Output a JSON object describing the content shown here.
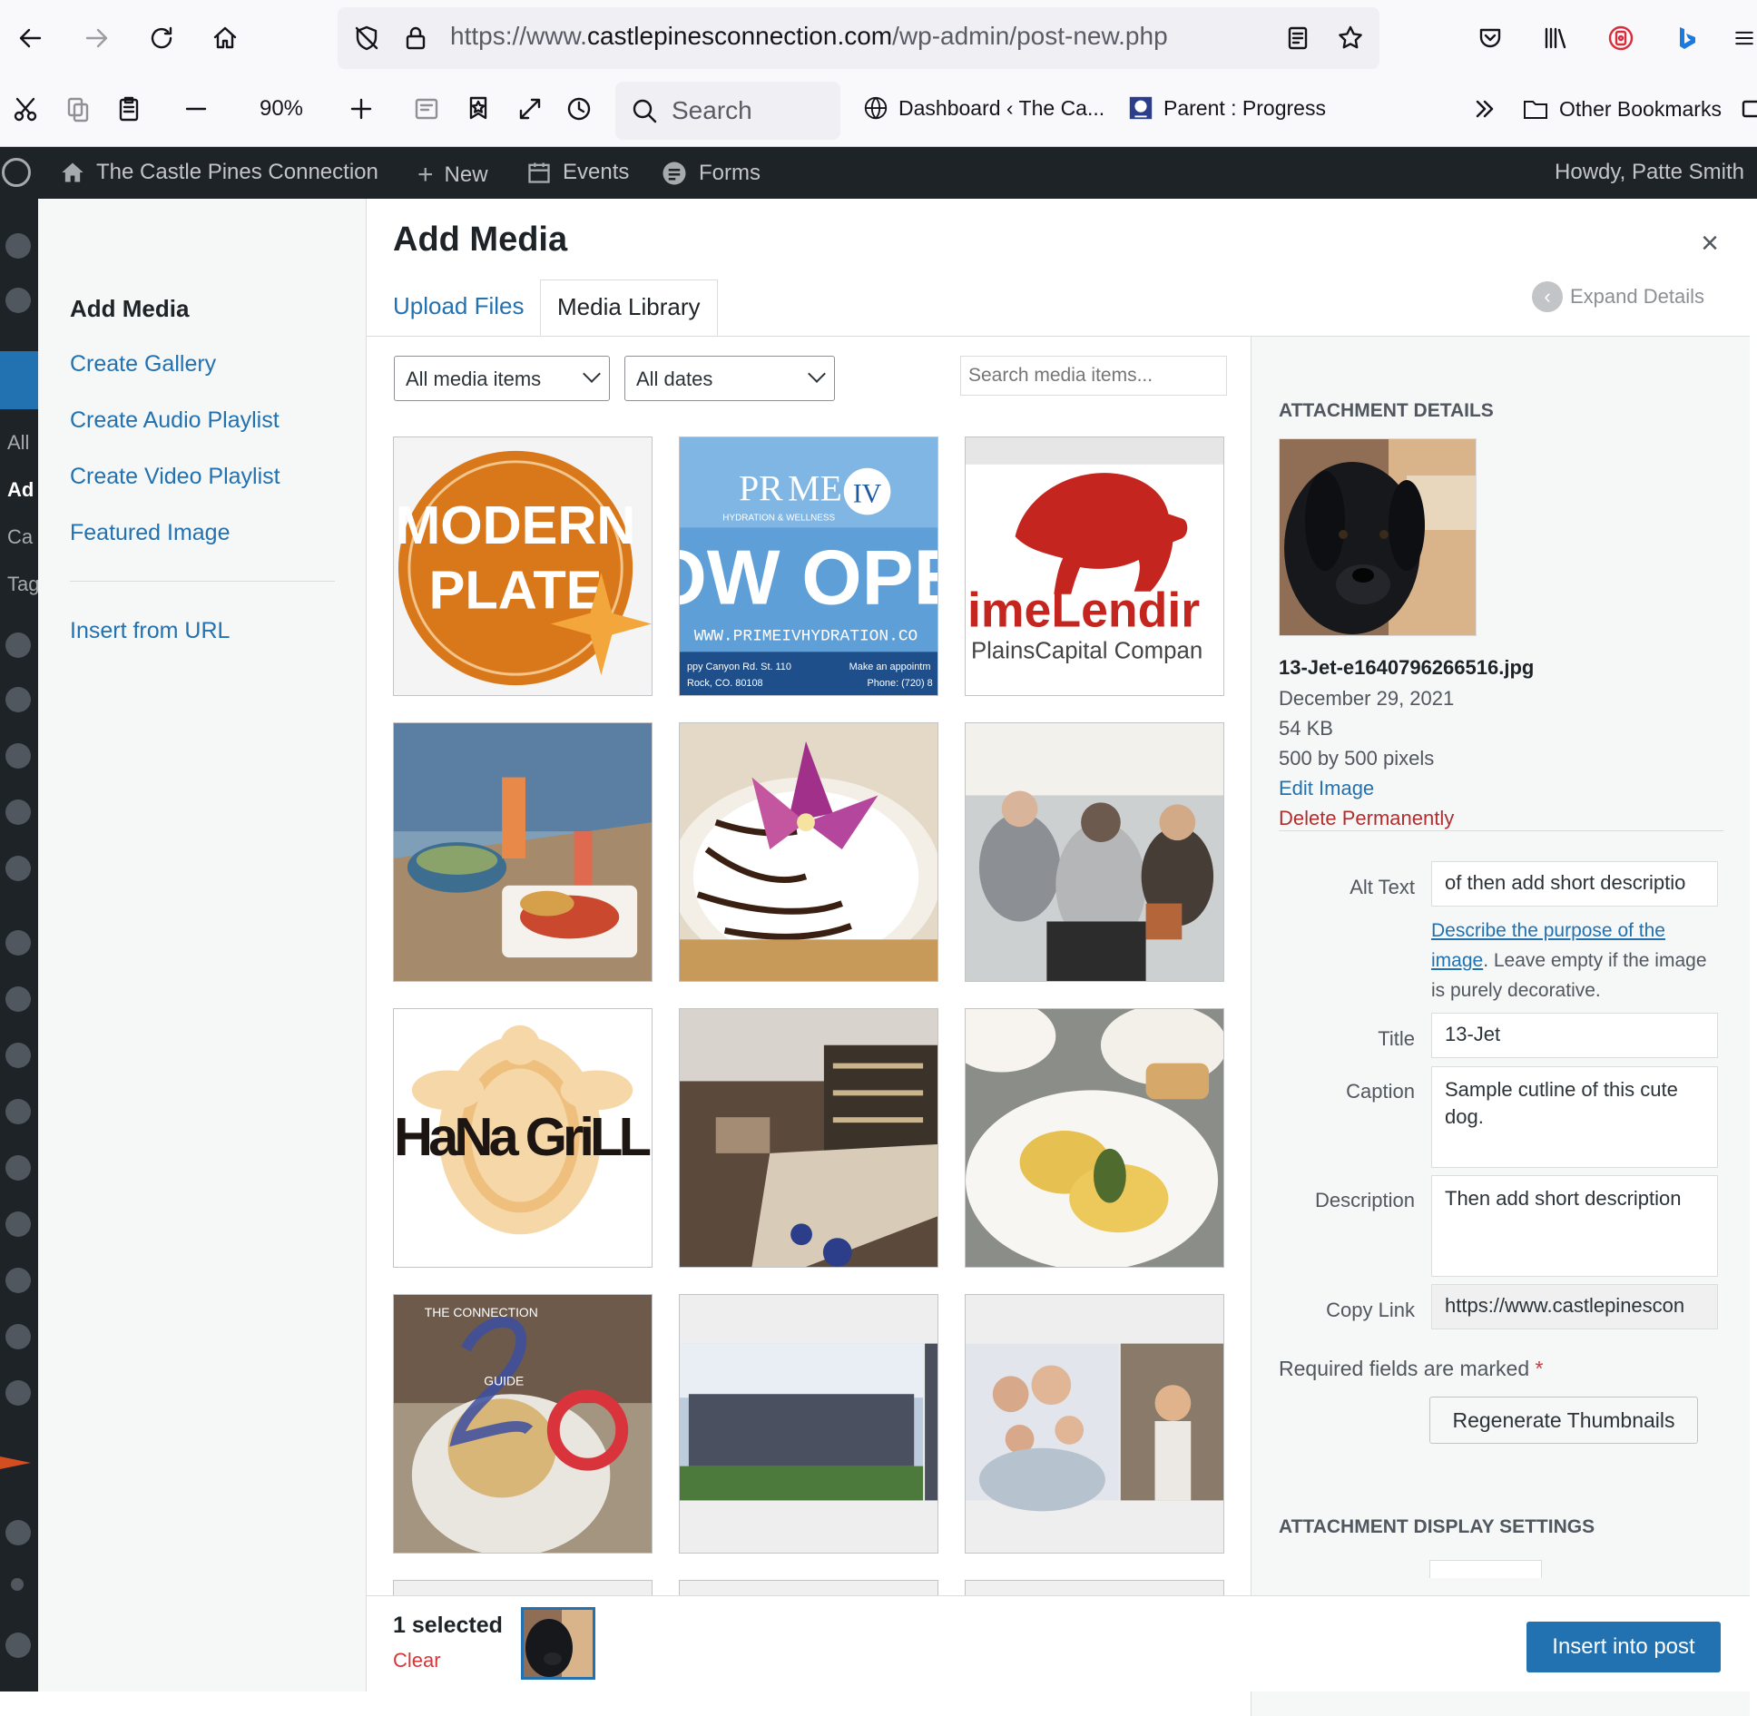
{
  "browser": {
    "url_prefix": "https://www.",
    "url_domain": "castlepinesconnection.com",
    "url_path": "/wp-admin/post-new.php",
    "zoom": "90%",
    "search_placeholder": "Search",
    "bookmarks": [
      "Dashboard ‹ The Ca...",
      "Parent : Progress"
    ],
    "other_bookmarks": "Other Bookmarks"
  },
  "adminbar": {
    "site_name": "The Castle Pines Connection",
    "new_label": "New",
    "events_label": "Events",
    "forms_label": "Forms",
    "greeting": "Howdy, Patte Smith"
  },
  "bg_sidebar_labels": [
    "All",
    "Ad",
    "Ca",
    "Tag"
  ],
  "media_menu": {
    "heading": "Add Media",
    "items": [
      "Create Gallery",
      "Create Audio Playlist",
      "Create Video Playlist",
      "Featured Image"
    ],
    "insert_url": "Insert from URL"
  },
  "frame": {
    "title": "Add Media",
    "close": "×",
    "tabs": [
      "Upload Files",
      "Media Library"
    ],
    "expand_details": "Expand Details"
  },
  "toolbar": {
    "type_filter": "All media items",
    "date_filter": "All dates",
    "search_placeholder": "Search media items..."
  },
  "thumbnails": {
    "modern_plate": [
      "MODERN",
      "PLATE"
    ],
    "prime_iv": [
      "PR",
      "ME",
      "IV",
      "HYDRATION & WELLNESS",
      "OW OPE",
      "WWW.PRIMEIVHYDRATION.CO",
      "ppy Canyon Rd. St. 110",
      "Rock, CO. 80108",
      "Make an appointm",
      "Phone: (720) 8"
    ],
    "prime_lending": [
      "imeLendir",
      "PlainsCapital Compan"
    ],
    "hana_grill": "HaNa GriLL",
    "connection_guide": [
      "THE CONNECTION",
      "GUIDE"
    ]
  },
  "attachment": {
    "section_title": "ATTACHMENT DETAILS",
    "filename": "13-Jet-e1640796266516.jpg",
    "date": "December 29, 2021",
    "size": "54 KB",
    "dimensions": "500 by 500 pixels",
    "edit_link": "Edit Image",
    "delete_link": "Delete Permanently",
    "alt_label": "Alt Text",
    "alt_value": "of then add short descriptio",
    "alt_help_link": "Describe the purpose of the image",
    "alt_help_text": ". Leave empty if the image is purely decorative.",
    "title_label": "Title",
    "title_value": "13-Jet",
    "caption_label": "Caption",
    "caption_value": "Sample cutline of this cute dog.",
    "description_label": "Description",
    "description_value": "Then add short description",
    "copy_link_label": "Copy Link",
    "copy_link_value": "https://www.castlepinescon",
    "required_note": "Required fields are marked",
    "required_star": "*",
    "regenerate": "Regenerate Thumbnails",
    "display_settings": "ATTACHMENT DISPLAY SETTINGS"
  },
  "footer": {
    "selected": "1 selected",
    "clear": "Clear",
    "insert": "Insert into post"
  }
}
